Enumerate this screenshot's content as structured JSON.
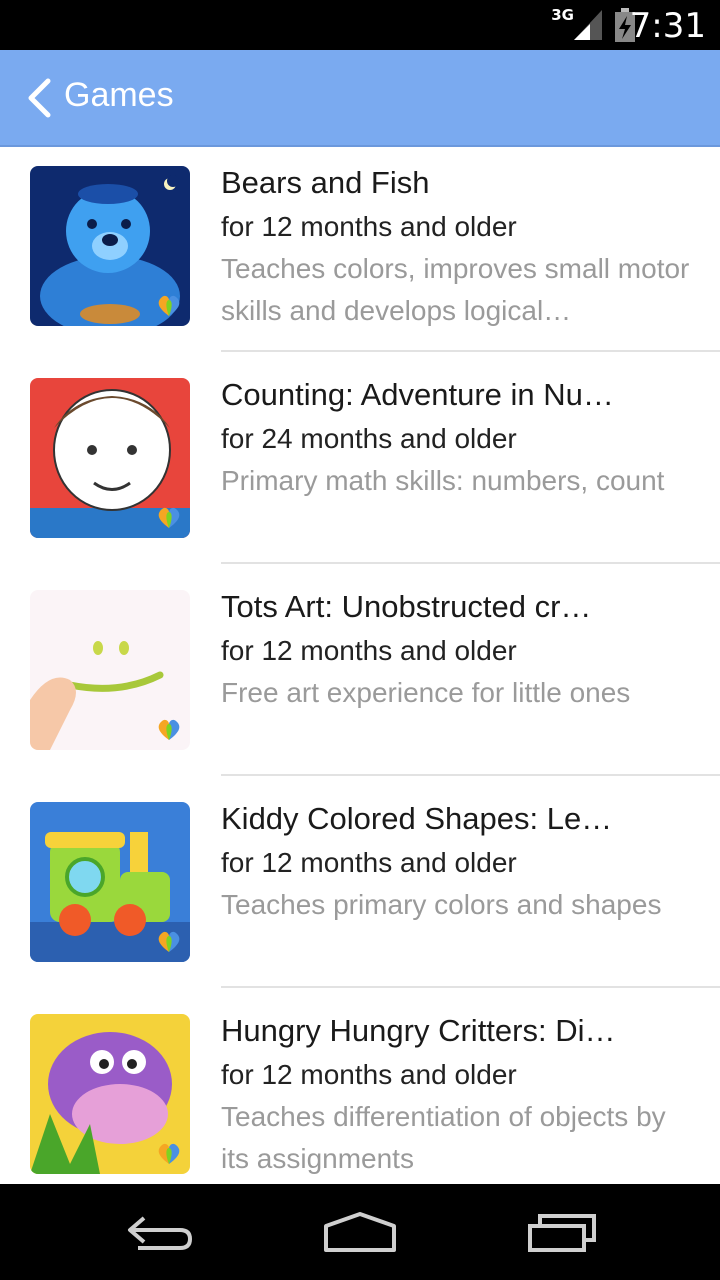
{
  "status_bar": {
    "network": "3G",
    "time": "7:31"
  },
  "action_bar": {
    "title": "Games",
    "back_icon": "chevron-left-icon"
  },
  "games": [
    {
      "name": "Bears and Fish",
      "age": "for 12 months and older",
      "description": "Teaches colors, improves small motor skills and develops logical…"
    },
    {
      "name": "Counting: Adventure in Nu…",
      "age": "for 24 months and older",
      "description": "Primary math skills: numbers, count"
    },
    {
      "name": "Tots Art: Unobstructed cr…",
      "age": "for 12 months and older",
      "description": "Free art experience for little ones"
    },
    {
      "name": "Kiddy Colored Shapes: Le…",
      "age": "for 12 months and older",
      "description": "Teaches primary colors and shapes"
    },
    {
      "name": "Hungry Hungry Critters: Di…",
      "age": "for 12 months and older",
      "description": "Teaches differentiation of objects by its assignments"
    }
  ],
  "nav_bar": {
    "back": "back-arrow-icon",
    "home": "home-icon",
    "recents": "recent-apps-icon"
  },
  "colors": {
    "action_bar": "#7aaaf0",
    "text_primary": "#1a1a1a",
    "text_secondary": "#9a9a9a"
  }
}
